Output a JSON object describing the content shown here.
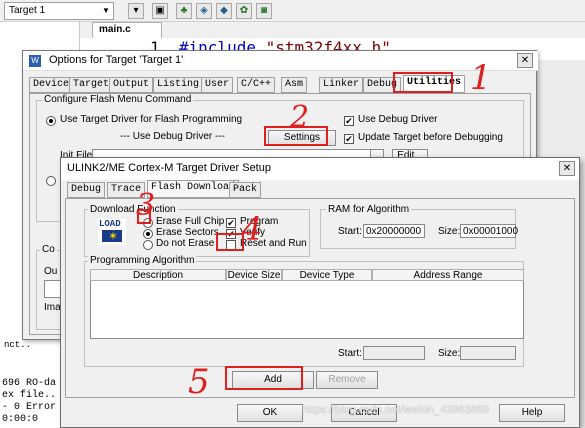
{
  "ide": {
    "target_name": "Target 1",
    "editor_tab": "main.c",
    "code_line_number": "1",
    "code_directive": "#include",
    "code_header": "\"stm32f4xx.h\"",
    "output_lines": [
      "696 RO-da",
      "ex file..",
      "- 0 Error",
      "0:00:0"
    ],
    "left_fragment": "nct.."
  },
  "options_dialog": {
    "title": "Options for Target 'Target 1'",
    "tabs": [
      "Device",
      "Target",
      "Output",
      "Listing",
      "User",
      "C/C++",
      "Asm",
      "Linker",
      "Debug",
      "Utilities"
    ],
    "active_tab": "Utilities",
    "group_flash_title": "Configure Flash Menu Command",
    "use_target_driver_label": "Use Target Driver for Flash Programming",
    "use_debug_driver_sub": "--- Use Debug Driver ---",
    "settings_button": "Settings",
    "use_debug_driver_label": "Use Debug Driver",
    "update_target_label": "Update Target before Debugging",
    "init_file_label": "Init File:",
    "browse_button": "...",
    "edit_button": "Edit...",
    "frag_co": "Co",
    "frag_ou": "Ou",
    "frag_ima": "Ima"
  },
  "ulink_dialog": {
    "title": "ULINK2/ME Cortex-M Target Driver Setup",
    "tabs": [
      "Debug",
      "Trace",
      "Flash Download",
      "Pack"
    ],
    "active_tab": "Flash Download",
    "download_function_title": "Download Function",
    "load_icon_text": "LOAD",
    "erase_full_chip": "Erase Full Chip",
    "erase_sectors": "Erase Sectors",
    "do_not_erase": "Do not Erase",
    "program": "Program",
    "verify": "Verify",
    "reset_and_run": "Reset and Run",
    "ram_title": "RAM for Algorithm",
    "start_label": "Start:",
    "start_value": "0x20000000",
    "size_label": "Size:",
    "size_value": "0x00001000",
    "prog_algo_title": "Programming Algorithm",
    "columns": [
      "Description",
      "Device Size",
      "Device Type",
      "Address Range"
    ],
    "start2_label": "Start:",
    "size2_label": "Size:",
    "add_button": "Add",
    "remove_button": "Remove",
    "ok_button": "OK",
    "cancel_button": "Cancel",
    "help_button": "Help"
  },
  "annotations": {
    "n1": "1",
    "n2": "2",
    "n3": "3",
    "n4": "4",
    "n5": "5",
    "watermark": "https://blog.csdn.net/weixin_43963658",
    "annotation_color": "#e02020"
  }
}
